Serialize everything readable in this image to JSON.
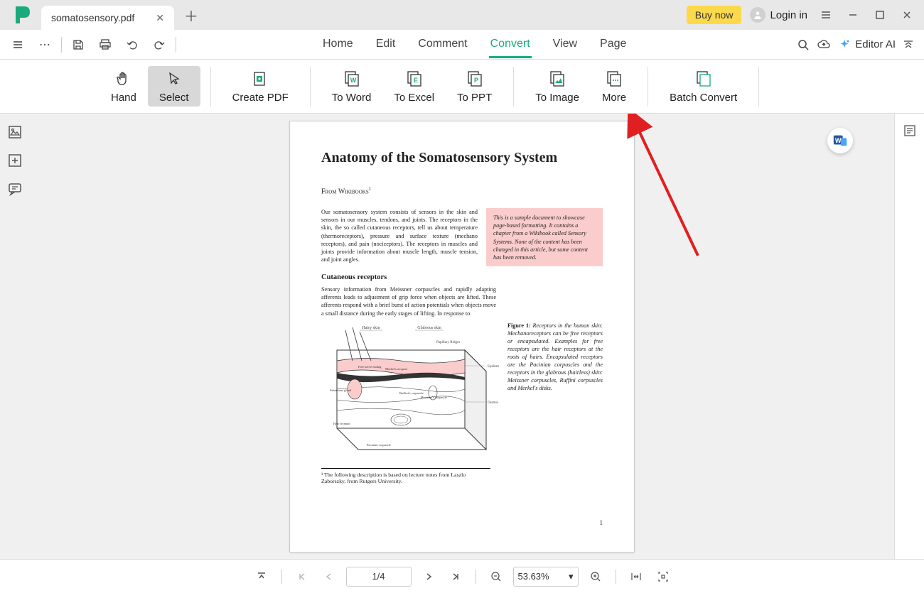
{
  "titlebar": {
    "tab_title": "somatosensory.pdf",
    "buy_now": "Buy now",
    "login": "Login in"
  },
  "menu": {
    "home": "Home",
    "edit": "Edit",
    "comment": "Comment",
    "convert": "Convert",
    "view": "View",
    "page": "Page",
    "editor_ai": "Editor AI"
  },
  "ribbon": {
    "hand": "Hand",
    "select": "Select",
    "create_pdf": "Create PDF",
    "to_word": "To Word",
    "to_excel": "To Excel",
    "to_ppt": "To PPT",
    "to_image": "To Image",
    "more": "More",
    "batch_convert": "Batch Convert"
  },
  "document": {
    "title": "Anatomy of the Somatosensory System",
    "from_label": "From Wikibooks",
    "from_sup": "1",
    "intro": "Our somatosensory system consists of sensors in the skin and sensors in our muscles, tendons, and joints. The receptors in the skin, the so called cutaneous receptors, tell us about temperature (thermoreceptors), pressure and surface texture (mechano receptors), and pain (nociceptors). The receptors in muscles and joints provide information about muscle length, muscle tension, and joint angles.",
    "callout": "This is a sample document to showcase page-based formatting. It contains a chapter from a Wikibook called Sensory Systems. None of the content has been changed in this article, but some content has been removed.",
    "subhead": "Cutaneous receptors",
    "para2": "Sensory information from Meissner corpuscles and rapidly adapting afferents leads to adjustment of grip force when objects are lifted. These afferents respond with a brief burst of action potentials when objects move a small distance during the early stages of lifting. In response to",
    "fig_caption": "Figure 1: Receptors in the human skin: Mechanoreceptors can be free receptors or encapsulated. Examples for free receptors are the hair receptors at the roots of hairs. Encapsulated receptors are the Pacinian corpuscles and the receptors in the glabrous (hairless) skin: Meissner corpuscles, Ruffini corpuscles and Merkel's disks.",
    "footnote": "¹ The following description is based on lecture notes from Laszlo Zaborszky, from Rutgers University.",
    "page_number": "1",
    "fig_labels": {
      "hairy_skin": "Hairy skin",
      "glabrous_skin": "Glabrous skin",
      "papillary": "Papillary Ridges",
      "epidermis": "Epidermis",
      "dermis": "Dermis",
      "merkel": "Merkel's receptor",
      "meissner": "Meissner's corpuscle",
      "free_nerve": "Free nerve ending",
      "sebaceous": "Sebaceous gland",
      "hair_receptor": "Hair receptor",
      "pacinian": "Pacinian corpuscle",
      "ruffini": "Ruffini's corpuscle"
    }
  },
  "status": {
    "page": "1/4",
    "zoom": "53.63%"
  }
}
